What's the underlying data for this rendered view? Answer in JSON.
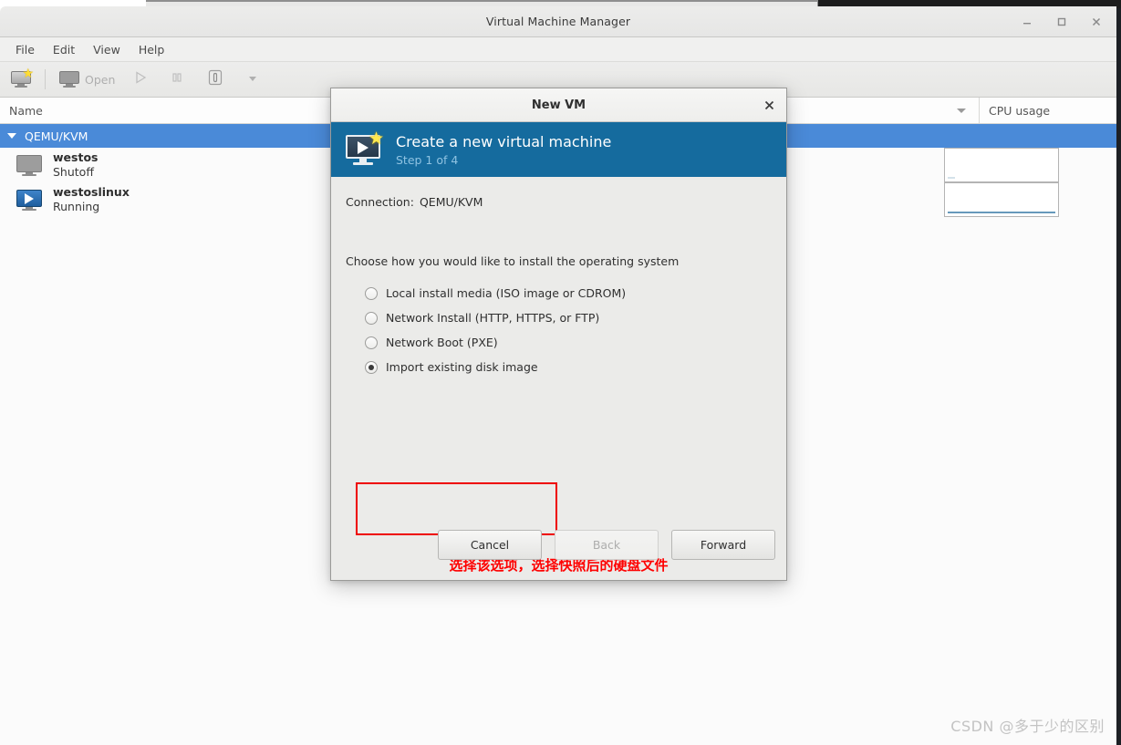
{
  "window": {
    "title": "Virtual Machine Manager",
    "controls": {
      "minimize": "minimize-icon",
      "maximize": "maximize-icon",
      "close": "close-icon"
    }
  },
  "menubar": {
    "items": [
      {
        "label": "File"
      },
      {
        "label": "Edit"
      },
      {
        "label": "View"
      },
      {
        "label": "Help"
      }
    ]
  },
  "toolbar": {
    "new_vm_icon": "new-vm-icon",
    "open_label": "Open",
    "open_icon": "monitor-icon",
    "run_icon": "play-icon",
    "pause_icon": "pause-icon",
    "shutdown_icon": "shutdown-icon",
    "dropdown_icon": "chevron-down-icon"
  },
  "vm_list": {
    "columns": {
      "name": "Name",
      "cpu_usage": "CPU usage",
      "sort_icon": "sort-descending-icon"
    },
    "connection": {
      "label": "QEMU/KVM",
      "expanded": true,
      "selected": true,
      "expander_icon": "triangle-down-icon"
    },
    "vms": [
      {
        "name": "westos",
        "state": "Shutoff",
        "icon": "monitor-off-icon",
        "cpu_sparkline": "flat-idle"
      },
      {
        "name": "westoslinux",
        "state": "Running",
        "icon": "monitor-running-icon",
        "cpu_sparkline": "flat-low"
      }
    ]
  },
  "dialog": {
    "title": "New VM",
    "close_icon": "close-icon",
    "banner": {
      "icon": "new-vm-wizard-icon",
      "title": "Create a new virtual machine",
      "step": "Step 1 of 4"
    },
    "connection": {
      "label": "Connection:",
      "value": "QEMU/KVM"
    },
    "prompt": "Choose how you would like to install the operating system",
    "options": [
      {
        "label": "Local install media (ISO image or CDROM)",
        "checked": false
      },
      {
        "label": "Network Install (HTTP, HTTPS, or FTP)",
        "checked": false
      },
      {
        "label": "Network Boot (PXE)",
        "checked": false
      },
      {
        "label": "Import existing disk image",
        "checked": true
      }
    ],
    "highlight": {
      "color": "#ee0000",
      "target_option_index": 3
    },
    "annotation": {
      "text": "选择该选项，选择快照后的硬盘文件",
      "color": "#fe0000"
    },
    "buttons": {
      "cancel": "Cancel",
      "back": "Back",
      "forward": "Forward",
      "back_disabled": true
    }
  },
  "watermark": {
    "text": "CSDN @多于少的区别"
  },
  "colors": {
    "selection_blue": "#4a8ad8",
    "banner_blue": "#156b9e",
    "highlight_red": "#ee0000",
    "annotation_red": "#fe0000",
    "sparkline_blue": "#6699bb"
  }
}
